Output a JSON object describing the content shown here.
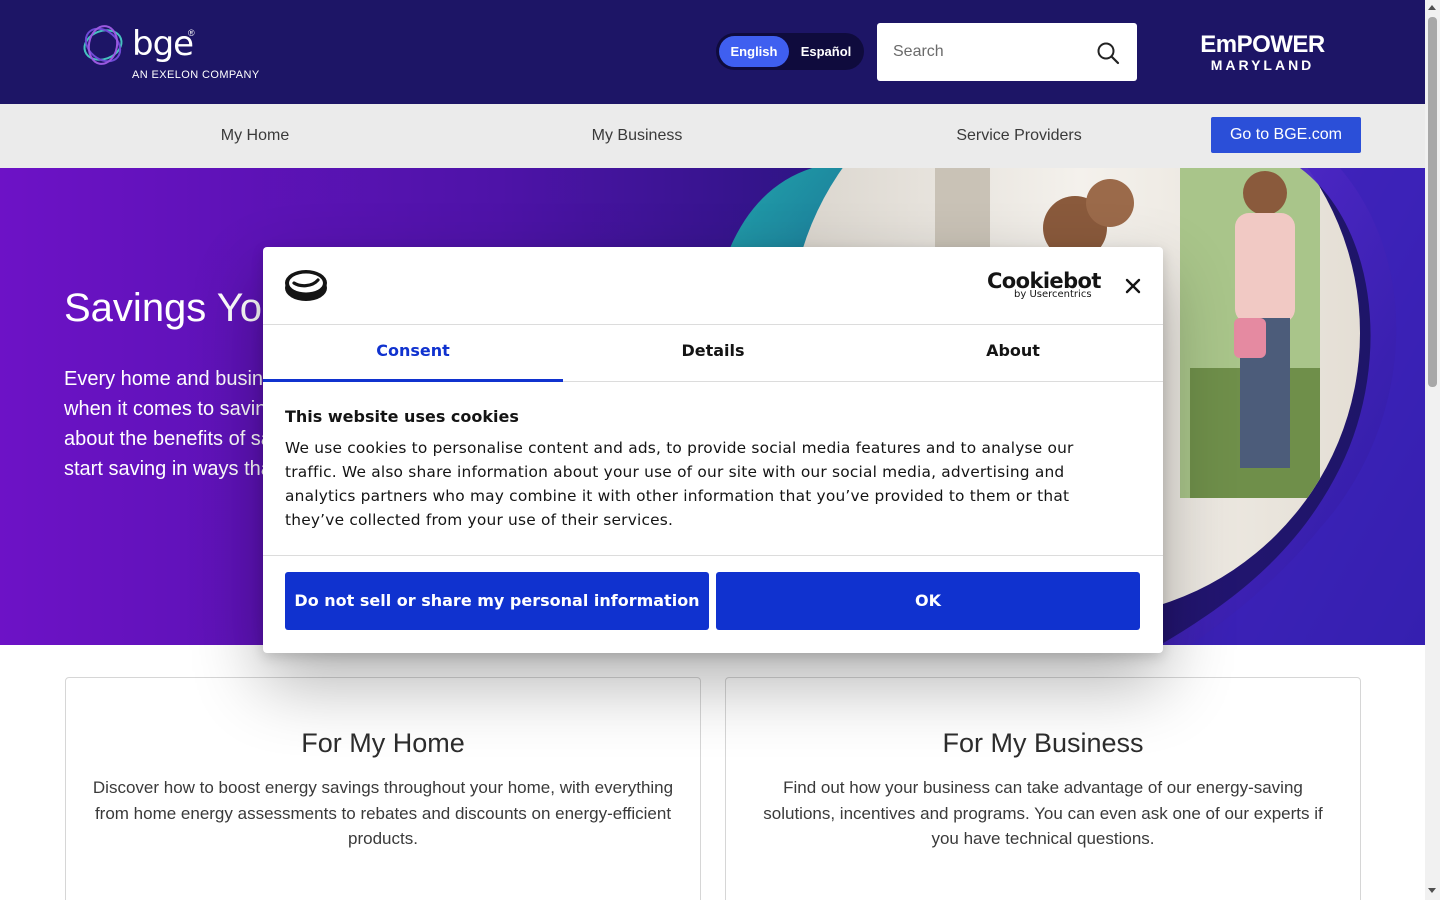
{
  "header": {
    "logo": {
      "brand": "bge",
      "registered_mark": "®",
      "subtitle": "AN EXELON COMPANY"
    },
    "language": {
      "active": "English",
      "inactive": "Español"
    },
    "search": {
      "placeholder": "Search",
      "icon": "search-icon"
    },
    "partner_logo": {
      "line1": "EmPOWER",
      "line2": "MARYLAND"
    }
  },
  "nav": {
    "items": [
      "My Home",
      "My Business",
      "Service Providers"
    ],
    "cta_label": "Go to BGE.com"
  },
  "hero": {
    "title": "Savings Your Way",
    "text": "Every home and business is different. That's why we give you options when it comes to saving energy. Explore our programs and learn about the benefits of saving energy in your space or workplace — and start saving in ways that work for you."
  },
  "cards": [
    {
      "title": "For My Home",
      "text": "Discover how to boost energy savings throughout your home, with everything from home energy assessments to rebates and discounts on energy-efficient products."
    },
    {
      "title": "For My Business",
      "text": "Find out how your business can take advantage of our energy-saving solutions, incentives and programs. You can even ask one of our experts if you have technical questions."
    }
  ],
  "cookie_dialog": {
    "brand": "Cookiebot",
    "brand_sub": "by Usercentrics",
    "tabs": [
      "Consent",
      "Details",
      "About"
    ],
    "active_tab": "Consent",
    "title": "This website uses cookies",
    "text": "We use cookies to personalise content and ads, to provide social media features and to analyse our traffic. We also share information about your use of our site with our social media, advertising and analytics partners who may combine it with other information that you’ve provided to them or that they’ve collected from your use of their services.",
    "decline_label": "Do not sell or share my personal information",
    "accept_label": "OK",
    "close_icon": "close-icon"
  },
  "colors": {
    "header_bg": "#1d1566",
    "nav_bg": "#ebebeb",
    "accent_blue": "#2b4fd8",
    "cookie_blue": "#1032cf",
    "hero_purple": "#6d12c6"
  }
}
